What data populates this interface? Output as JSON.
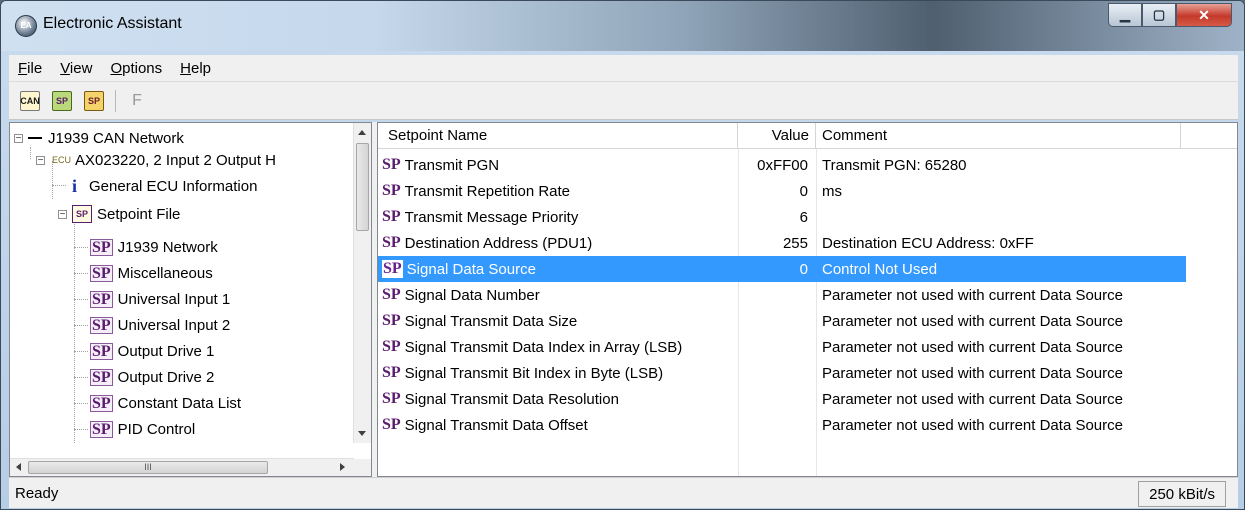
{
  "window": {
    "title": "Electronic Assistant",
    "app_icon": "EA"
  },
  "menubar": {
    "items": [
      {
        "label": "File",
        "accel": "F",
        "rest": "ile"
      },
      {
        "label": "View",
        "accel": "V",
        "rest": "iew"
      },
      {
        "label": "Options",
        "accel": "O",
        "rest": "ptions"
      },
      {
        "label": "Help",
        "accel": "H",
        "rest": "elp"
      }
    ]
  },
  "toolbar": {
    "can_label": "CAN",
    "sp_label": "SP",
    "f_label": "F"
  },
  "tree": {
    "network": "J1939 CAN Network",
    "ecu_tag": "ECU",
    "ecu": "AX023220, 2 Input 2 Output H",
    "general_info": "General ECU Information",
    "setpoint_file": "Setpoint File",
    "sp_badge": "SP",
    "sp_file_icon_text": "SP",
    "info_glyph": "i",
    "items": [
      "J1939 Network",
      "Miscellaneous",
      "Universal Input 1",
      "Universal Input 2",
      "Output Drive 1",
      "Output Drive 2",
      "Constant Data List",
      "PID Control"
    ],
    "hscroll_grip": "III"
  },
  "grid": {
    "headers": {
      "name": "Setpoint Name",
      "value": "Value",
      "comment": "Comment"
    },
    "sp_badge": "SP",
    "rows": [
      {
        "name": "Transmit PGN",
        "value": "0xFF00",
        "comment": "Transmit PGN: 65280"
      },
      {
        "name": "Transmit Repetition Rate",
        "value": "0",
        "comment": "ms"
      },
      {
        "name": "Transmit Message Priority",
        "value": "6",
        "comment": ""
      },
      {
        "name": "Destination Address (PDU1)",
        "value": "255",
        "comment": "Destination ECU Address: 0xFF"
      },
      {
        "name": "Signal Data Source",
        "value": "0",
        "comment": "Control Not Used"
      },
      {
        "name": "Signal Data Number",
        "value": "",
        "comment": "Parameter not used with current Data Source"
      },
      {
        "name": "Signal Transmit Data Size",
        "value": "",
        "comment": "Parameter not used with current Data Source"
      },
      {
        "name": "Signal Transmit Data Index in Array (LSB)",
        "value": "",
        "comment": "Parameter not used with current Data Source"
      },
      {
        "name": "Signal Transmit Bit Index in Byte (LSB)",
        "value": "",
        "comment": "Parameter not used with current Data Source"
      },
      {
        "name": "Signal Transmit Data Resolution",
        "value": "",
        "comment": "Parameter not used with current Data Source"
      },
      {
        "name": "Signal Transmit Data Offset",
        "value": "",
        "comment": "Parameter not used with current Data Source"
      }
    ],
    "selected_row": 4
  },
  "statusbar": {
    "text": "Ready",
    "bitrate": "250 kBit/s"
  },
  "colors": {
    "selection": "#3399ff",
    "sp_purple": "#5a1d6e",
    "info_blue": "#1a2ea8"
  }
}
